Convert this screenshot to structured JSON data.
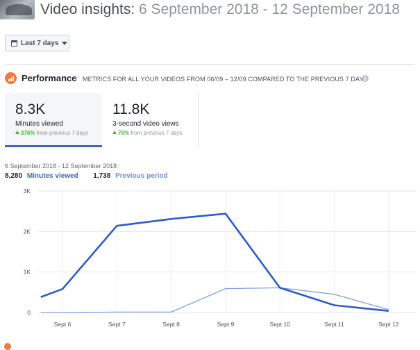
{
  "header": {
    "title": "Video insights:",
    "range": "6 September 2018 - 12 September 2018"
  },
  "controls": {
    "range_button_label": "Last 7 days"
  },
  "performance": {
    "title": "Performance",
    "subtitle": "METRICS FOR ALL YOUR VIDEOS FROM 06/09 – 12/09 COMPARED TO THE PREVIOUS 7 DAYS",
    "info_glyph": "i",
    "cards": [
      {
        "value": "8.3K",
        "label": "Minutes viewed",
        "change": "376%",
        "change_suffix": "from previous 7 days"
      },
      {
        "value": "11.8K",
        "label": "3-second video views",
        "change": "76%",
        "change_suffix": "from previous 7 days"
      }
    ]
  },
  "chart_header": {
    "date_range": "6 September 2018 - 12 September 2018",
    "current_value": "8,280",
    "current_label": "Minutes viewed",
    "previous_value": "1,738",
    "previous_label": "Previous period"
  },
  "colors": {
    "current": "#2d5bc8",
    "previous": "#7f9fdc",
    "accent": "#f5793b",
    "up": "#42b72a"
  },
  "chart_data": {
    "type": "line",
    "categories": [
      "Sept 6",
      "Sept 7",
      "Sept 8",
      "Sept 9",
      "Sept 10",
      "Sept 11",
      "Sept 12"
    ],
    "y_ticks": [
      "3K",
      "2K",
      "1K",
      "0"
    ],
    "ylim": [
      0,
      3000
    ],
    "grid": true,
    "series": [
      {
        "name": "Minutes viewed",
        "x": [
          5.6,
          6,
          7,
          8,
          9,
          10,
          11,
          12
        ],
        "values": [
          380,
          580,
          2140,
          2310,
          2440,
          610,
          180,
          40
        ]
      },
      {
        "name": "Previous period",
        "x": [
          5.6,
          6,
          7,
          8,
          9,
          10,
          11,
          12
        ],
        "values": [
          0,
          0,
          10,
          10,
          590,
          610,
          450,
          70
        ]
      }
    ]
  }
}
